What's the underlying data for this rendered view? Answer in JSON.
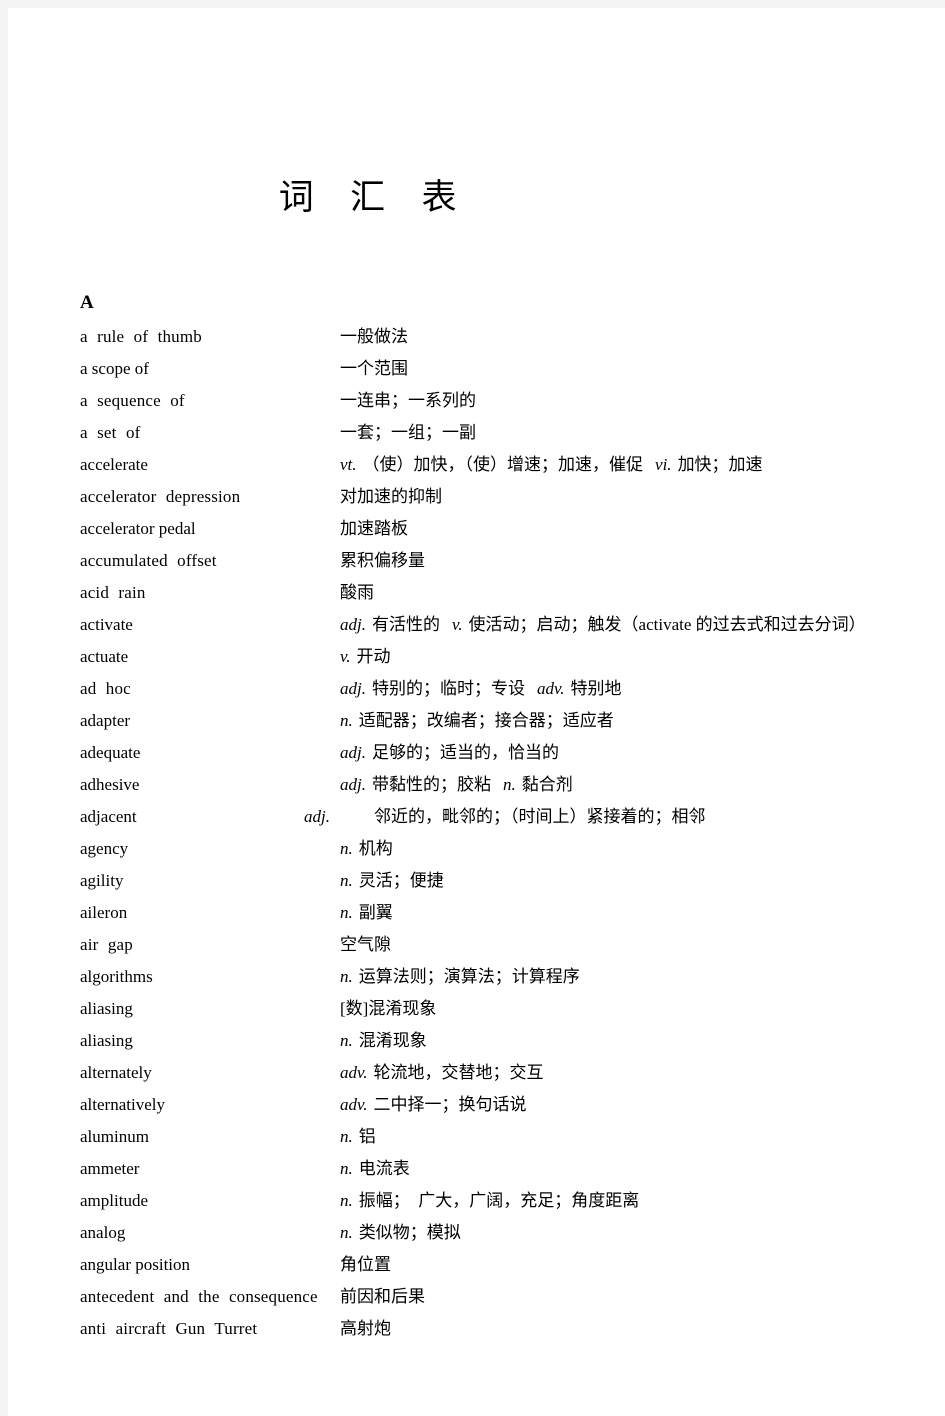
{
  "document": {
    "title": "词　汇　表",
    "section_letter": "A"
  },
  "entries": [
    {
      "term": "a  rule  of  thumb",
      "pos": "",
      "definition": "一般做法"
    },
    {
      "term": "a scope of",
      "pos": "",
      "definition": "一个范围"
    },
    {
      "term": "a  sequence  of",
      "pos": "",
      "definition": "一连串；一系列的"
    },
    {
      "term": "a  set  of",
      "pos": "",
      "definition": "一套；一组；一副"
    },
    {
      "term": "accelerate",
      "pos": "vt.",
      "definition": "（使）加快，（使）增速；加速，催促",
      "pos2": "vi.",
      "definition2": "加快；加速"
    },
    {
      "term": "accelerator  depression",
      "pos": "",
      "definition": "对加速的抑制"
    },
    {
      "term": "accelerator pedal",
      "pos": "",
      "definition": "加速踏板"
    },
    {
      "term": "accumulated  offset",
      "pos": "",
      "definition": "累积偏移量"
    },
    {
      "term": "acid  rain",
      "pos": "",
      "definition": "酸雨"
    },
    {
      "term": "activate",
      "pos": "adj.",
      "definition": "有活性的",
      "pos2": "v.",
      "definition2": "使活动；启动；触发（activate 的过去式和过去分词）"
    },
    {
      "term": "actuate",
      "pos": "v.",
      "definition": "开动"
    },
    {
      "term": "ad  hoc",
      "pos": "adj.",
      "definition": "特别的；临时；专设",
      "pos2": "adv.",
      "definition2": "特别地"
    },
    {
      "term": "adapter",
      "pos": "n.",
      "definition": "适配器；改编者；接合器；适应者"
    },
    {
      "term": "adequate",
      "pos": "adj.",
      "definition": "足够的；适当的，恰当的"
    },
    {
      "term": "adhesive",
      "pos": "adj.",
      "definition": "带黏性的；胶粘",
      "pos2": "n.",
      "definition2": "黏合剂"
    },
    {
      "term": "adjacent",
      "pos": "adj.",
      "definition": "邻近的，毗邻的；（时间上）紧接着的；相邻"
    },
    {
      "term": "agency",
      "pos": "n.",
      "definition": "机构"
    },
    {
      "term": "agility",
      "pos": "n.",
      "definition": "灵活；便捷"
    },
    {
      "term": "aileron",
      "pos": "n.",
      "definition": "副翼"
    },
    {
      "term": "air  gap",
      "pos": "",
      "definition": "空气隙"
    },
    {
      "term": "algorithms",
      "pos": "n.",
      "definition": "运算法则；演算法；计算程序"
    },
    {
      "term": "aliasing",
      "pos": "",
      "definition": "[数]混淆现象"
    },
    {
      "term": "aliasing",
      "pos": "n.",
      "definition": "混淆现象"
    },
    {
      "term": "alternately",
      "pos": "adv.",
      "definition": "轮流地，交替地；交互"
    },
    {
      "term": "alternatively",
      "pos": "adv.",
      "definition": "二中择一；换句话说"
    },
    {
      "term": "aluminum",
      "pos": "n.",
      "definition": "铝"
    },
    {
      "term": "ammeter",
      "pos": "n.",
      "definition": "电流表"
    },
    {
      "term": "amplitude",
      "pos": "n.",
      "definition": "振幅；　广大，广阔，充足；角度距离"
    },
    {
      "term": "analog",
      "pos": "n.",
      "definition": "类似物；模拟"
    },
    {
      "term": "angular position",
      "pos": "",
      "definition": "角位置"
    },
    {
      "term": "antecedent  and  the  consequence",
      "pos": "",
      "definition": "前因和后果"
    },
    {
      "term": "anti  aircraft  Gun  Turret",
      "pos": "",
      "definition": "高射炮"
    }
  ]
}
